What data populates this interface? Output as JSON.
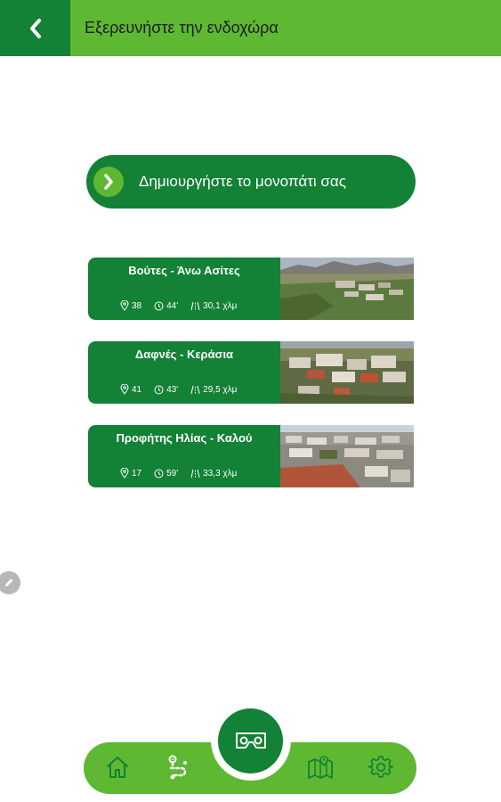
{
  "header": {
    "title": "Εξερευνήστε την ενδοχώρα",
    "back_icon": "chevron-left-icon"
  },
  "create_route": {
    "label": "Δημιουργήστε το μονοπάτι σας",
    "icon": "chevron-right-icon"
  },
  "routes": [
    {
      "title": "Βούτες - Άνω Ασίτες",
      "points": "38",
      "duration": "44'",
      "distance": "30,1 χλμ"
    },
    {
      "title": "Δαφνές - Κεράσια",
      "points": "41",
      "duration": "43'",
      "distance": "29,5 χλμ"
    },
    {
      "title": "Προφήτης Ηλίας - Καλού",
      "points": "17",
      "duration": "59'",
      "distance": "33,3 χλμ"
    }
  ],
  "bottom_nav": {
    "items": [
      "home-icon",
      "route-icon",
      "vr-headset-icon",
      "map-icon",
      "settings-gear-icon"
    ]
  },
  "colors": {
    "light_green": "#5fb832",
    "dark_green": "#138136",
    "white": "#ffffff"
  }
}
